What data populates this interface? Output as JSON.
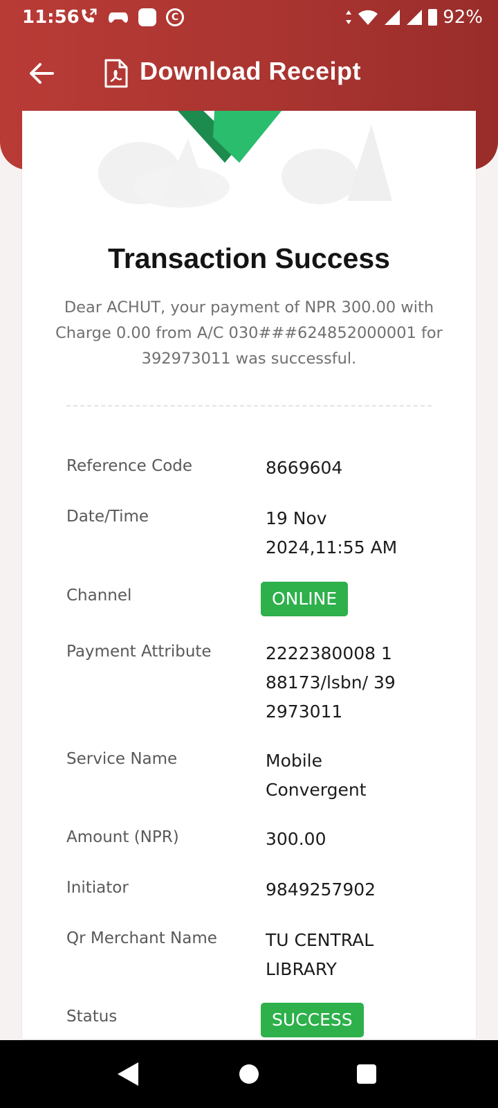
{
  "status_bar": {
    "time": "11:56",
    "battery": "92%",
    "left_icons": [
      "call-forward-icon",
      "game-controller-icon",
      "app-square-icon",
      "c-app-icon"
    ],
    "right_icons": [
      "data-arrows-icon",
      "wifi-icon",
      "signal-icon",
      "signal-icon-2",
      "battery-icon"
    ]
  },
  "header": {
    "title": "Download Receipt",
    "back_icon": "back-arrow-icon",
    "title_icon": "pdf-document-icon"
  },
  "receipt": {
    "heading": "Transaction Success",
    "message": "Dear ACHUT, your payment of NPR 300.00 with Charge 0.00 from A/C 030###624852000001 for 392973011 was successful.",
    "details": {
      "reference_code": {
        "label": "Reference Code",
        "value": "8669604"
      },
      "date_time": {
        "label": "Date/Time",
        "value": "19 Nov 2024,11:55 AM"
      },
      "channel": {
        "label": "Channel",
        "value": "ONLINE"
      },
      "payment_attribute": {
        "label": "Payment Attribute",
        "value": "2222380008 188173/lsbn/ 392973011"
      },
      "service_name": {
        "label": "Service Name",
        "value": "Mobile Convergent"
      },
      "amount": {
        "label": "Amount (NPR)",
        "value": "300.00"
      },
      "initiator": {
        "label": "Initiator",
        "value": "9849257902"
      },
      "qr_merchant": {
        "label": "Qr Merchant Name",
        "value": "TU CENTRAL LIBRARY"
      },
      "status": {
        "label": "Status",
        "value": "SUCCESS"
      }
    }
  },
  "colors": {
    "header": "#b93b36",
    "badge_green": "#2eb04b",
    "check_green": "#27a862"
  },
  "nav_bar": {
    "icons": [
      "nav-back-icon",
      "nav-home-icon",
      "nav-recents-icon"
    ]
  }
}
